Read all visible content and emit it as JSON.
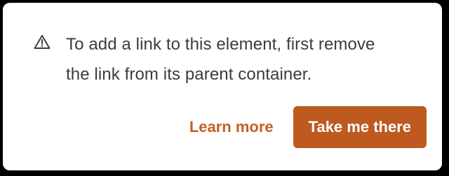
{
  "notice": {
    "icon": "warning-triangle-icon",
    "line1": "To add a link to this element, first remove",
    "line2": "the link from its parent container."
  },
  "actions": {
    "learn_more_label": "Learn more",
    "take_me_there_label": "Take me there"
  },
  "colors": {
    "accent": "#be5a1f",
    "link": "#c46024",
    "text": "#3c3c3c",
    "background": "#ffffff"
  }
}
